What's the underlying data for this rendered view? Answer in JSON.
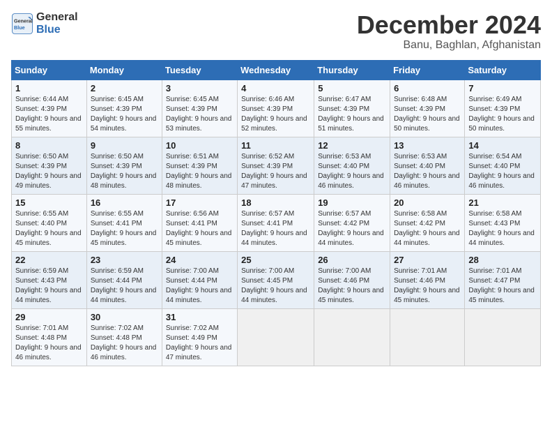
{
  "logo": {
    "line1": "General",
    "line2": "Blue"
  },
  "title": "December 2024",
  "subtitle": "Banu, Baghlan, Afghanistan",
  "days_header": [
    "Sunday",
    "Monday",
    "Tuesday",
    "Wednesday",
    "Thursday",
    "Friday",
    "Saturday"
  ],
  "weeks": [
    [
      {
        "day": "1",
        "sunrise": "6:44 AM",
        "sunset": "4:39 PM",
        "daylight": "9 hours and 55 minutes."
      },
      {
        "day": "2",
        "sunrise": "6:45 AM",
        "sunset": "4:39 PM",
        "daylight": "9 hours and 54 minutes."
      },
      {
        "day": "3",
        "sunrise": "6:45 AM",
        "sunset": "4:39 PM",
        "daylight": "9 hours and 53 minutes."
      },
      {
        "day": "4",
        "sunrise": "6:46 AM",
        "sunset": "4:39 PM",
        "daylight": "9 hours and 52 minutes."
      },
      {
        "day": "5",
        "sunrise": "6:47 AM",
        "sunset": "4:39 PM",
        "daylight": "9 hours and 51 minutes."
      },
      {
        "day": "6",
        "sunrise": "6:48 AM",
        "sunset": "4:39 PM",
        "daylight": "9 hours and 50 minutes."
      },
      {
        "day": "7",
        "sunrise": "6:49 AM",
        "sunset": "4:39 PM",
        "daylight": "9 hours and 50 minutes."
      }
    ],
    [
      {
        "day": "8",
        "sunrise": "6:50 AM",
        "sunset": "4:39 PM",
        "daylight": "9 hours and 49 minutes."
      },
      {
        "day": "9",
        "sunrise": "6:50 AM",
        "sunset": "4:39 PM",
        "daylight": "9 hours and 48 minutes."
      },
      {
        "day": "10",
        "sunrise": "6:51 AM",
        "sunset": "4:39 PM",
        "daylight": "9 hours and 48 minutes."
      },
      {
        "day": "11",
        "sunrise": "6:52 AM",
        "sunset": "4:39 PM",
        "daylight": "9 hours and 47 minutes."
      },
      {
        "day": "12",
        "sunrise": "6:53 AM",
        "sunset": "4:40 PM",
        "daylight": "9 hours and 46 minutes."
      },
      {
        "day": "13",
        "sunrise": "6:53 AM",
        "sunset": "4:40 PM",
        "daylight": "9 hours and 46 minutes."
      },
      {
        "day": "14",
        "sunrise": "6:54 AM",
        "sunset": "4:40 PM",
        "daylight": "9 hours and 46 minutes."
      }
    ],
    [
      {
        "day": "15",
        "sunrise": "6:55 AM",
        "sunset": "4:40 PM",
        "daylight": "9 hours and 45 minutes."
      },
      {
        "day": "16",
        "sunrise": "6:55 AM",
        "sunset": "4:41 PM",
        "daylight": "9 hours and 45 minutes."
      },
      {
        "day": "17",
        "sunrise": "6:56 AM",
        "sunset": "4:41 PM",
        "daylight": "9 hours and 45 minutes."
      },
      {
        "day": "18",
        "sunrise": "6:57 AM",
        "sunset": "4:41 PM",
        "daylight": "9 hours and 44 minutes."
      },
      {
        "day": "19",
        "sunrise": "6:57 AM",
        "sunset": "4:42 PM",
        "daylight": "9 hours and 44 minutes."
      },
      {
        "day": "20",
        "sunrise": "6:58 AM",
        "sunset": "4:42 PM",
        "daylight": "9 hours and 44 minutes."
      },
      {
        "day": "21",
        "sunrise": "6:58 AM",
        "sunset": "4:43 PM",
        "daylight": "9 hours and 44 minutes."
      }
    ],
    [
      {
        "day": "22",
        "sunrise": "6:59 AM",
        "sunset": "4:43 PM",
        "daylight": "9 hours and 44 minutes."
      },
      {
        "day": "23",
        "sunrise": "6:59 AM",
        "sunset": "4:44 PM",
        "daylight": "9 hours and 44 minutes."
      },
      {
        "day": "24",
        "sunrise": "7:00 AM",
        "sunset": "4:44 PM",
        "daylight": "9 hours and 44 minutes."
      },
      {
        "day": "25",
        "sunrise": "7:00 AM",
        "sunset": "4:45 PM",
        "daylight": "9 hours and 44 minutes."
      },
      {
        "day": "26",
        "sunrise": "7:00 AM",
        "sunset": "4:46 PM",
        "daylight": "9 hours and 45 minutes."
      },
      {
        "day": "27",
        "sunrise": "7:01 AM",
        "sunset": "4:46 PM",
        "daylight": "9 hours and 45 minutes."
      },
      {
        "day": "28",
        "sunrise": "7:01 AM",
        "sunset": "4:47 PM",
        "daylight": "9 hours and 45 minutes."
      }
    ],
    [
      {
        "day": "29",
        "sunrise": "7:01 AM",
        "sunset": "4:48 PM",
        "daylight": "9 hours and 46 minutes."
      },
      {
        "day": "30",
        "sunrise": "7:02 AM",
        "sunset": "4:48 PM",
        "daylight": "9 hours and 46 minutes."
      },
      {
        "day": "31",
        "sunrise": "7:02 AM",
        "sunset": "4:49 PM",
        "daylight": "9 hours and 47 minutes."
      },
      null,
      null,
      null,
      null
    ]
  ],
  "labels": {
    "sunrise": "Sunrise:",
    "sunset": "Sunset:",
    "daylight": "Daylight:"
  }
}
